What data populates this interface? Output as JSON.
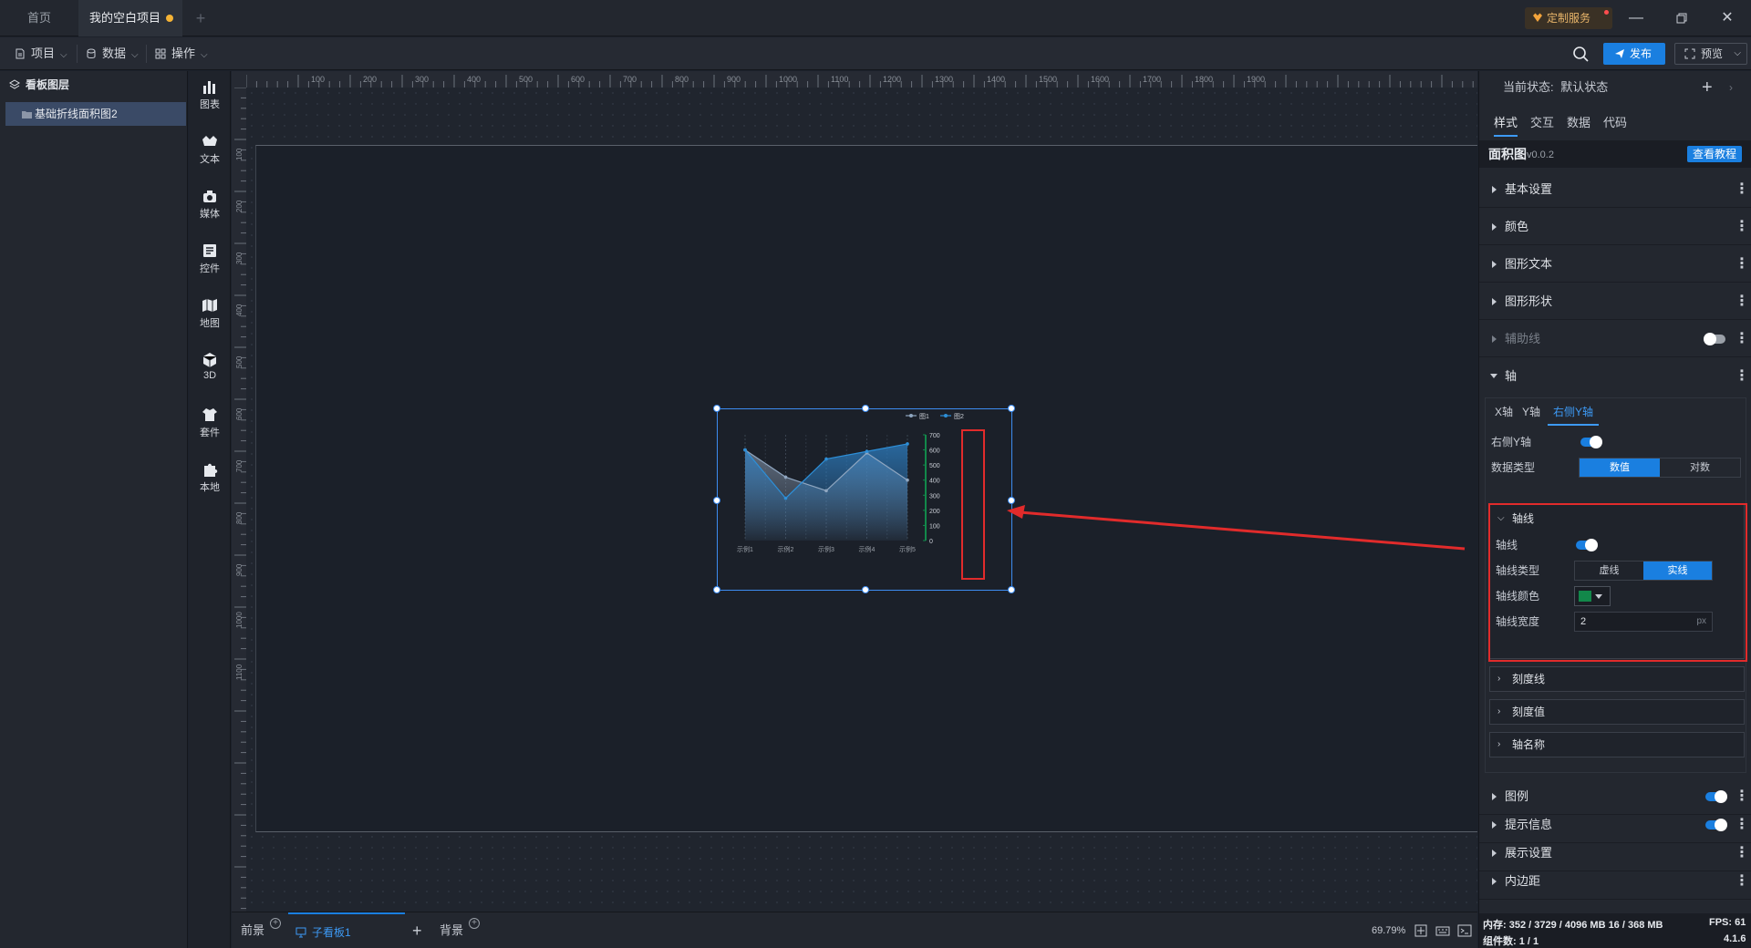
{
  "tabs": {
    "home": "首页",
    "project": "我的空白项目"
  },
  "custom_service": "定制服务",
  "toolbar": {
    "project": "项目",
    "data": "数据",
    "operate": "操作",
    "publish": "发布",
    "preview": "预览"
  },
  "layers": {
    "header": "看板图层",
    "item": "基础折线面积图2"
  },
  "components": [
    "图表",
    "文本",
    "媒体",
    "控件",
    "地图",
    "3D",
    "套件",
    "本地"
  ],
  "ruler": {
    "top": [
      "100",
      "200",
      "300",
      "400",
      "500",
      "600",
      "700",
      "800",
      "900",
      "1000",
      "1100",
      "1200",
      "1300",
      "1400",
      "1500",
      "1600",
      "1700",
      "1800",
      "1900"
    ],
    "left": [
      "100",
      "200",
      "300",
      "400",
      "500",
      "600",
      "700",
      "800",
      "900",
      "1000",
      "1100"
    ]
  },
  "chart_data": {
    "type": "area",
    "categories": [
      "示例1",
      "示例2",
      "示例3",
      "示例4",
      "示例5"
    ],
    "series": [
      {
        "name": "图1",
        "values": [
          600,
          420,
          330,
          580,
          400
        ],
        "color": "#8fa6c0"
      },
      {
        "name": "图2",
        "values": [
          600,
          280,
          540,
          590,
          640
        ],
        "color": "#2d8fd8"
      }
    ],
    "y_ticks": [
      "700",
      "600",
      "500",
      "400",
      "300",
      "200",
      "100",
      "0"
    ],
    "ylim": [
      0,
      700
    ],
    "legend": "top-right",
    "axis_color": "#12884a"
  },
  "bottom": {
    "foreground": "前景",
    "subboard": "子看板1",
    "background": "背景",
    "zoom": "69.79%"
  },
  "panel": {
    "state_label": "当前状态:",
    "state_value": "默认状态",
    "tabs": [
      "样式",
      "交互",
      "数据",
      "代码"
    ],
    "component_name": "面积图",
    "component_version": "v0.0.2",
    "tutorial": "查看教程",
    "sections_top": [
      "基本设置",
      "颜色",
      "图形文本",
      "图形形状",
      "辅助线",
      "轴"
    ],
    "axis_tabs": [
      "X轴",
      "Y轴",
      "右侧Y轴"
    ],
    "right_y_label": "右侧Y轴",
    "data_type_label": "数据类型",
    "data_type_options": [
      "数值",
      "对数"
    ],
    "axis_line": {
      "title": "轴线",
      "toggle_label": "轴线",
      "type_label": "轴线类型",
      "type_options": [
        "虚线",
        "实线"
      ],
      "color_label": "轴线颜色",
      "color": "#12884a",
      "width_label": "轴线宽度",
      "width_value": "2",
      "width_unit": "px"
    },
    "sub_sections": [
      "刻度线",
      "刻度值",
      "轴名称"
    ],
    "sections_bottom": [
      "图例",
      "提示信息",
      "展示设置",
      "内边距"
    ]
  },
  "status": {
    "memory": "内存: 352 / 3729 / 4096 MB 16 / 368 MB",
    "fps": "FPS: 61",
    "components": "组件数: 1 / 1",
    "version": "4.1.6"
  }
}
